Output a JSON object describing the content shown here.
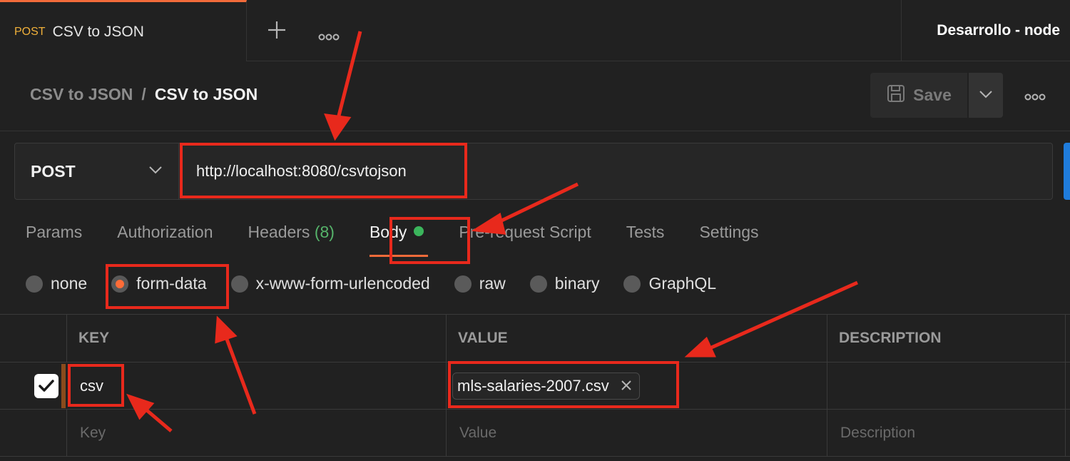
{
  "tabbar": {
    "active_tab": {
      "method": "POST",
      "name": "CSV to JSON"
    },
    "new_tab_icon": "plus-icon",
    "more_icon": "ellipsis-icon",
    "environment": "Desarrollo - node"
  },
  "header": {
    "breadcrumb": {
      "parent": "CSV to JSON",
      "separator": "/",
      "current": "CSV to JSON"
    },
    "save_label": "Save",
    "save_icon": "floppy-disk-icon",
    "more_icon": "ellipsis-icon"
  },
  "request": {
    "method": "POST",
    "url": "http://localhost:8080/csvtojson",
    "send_color": "#1f7cdc"
  },
  "tabs": [
    {
      "label": "Params"
    },
    {
      "label": "Authorization"
    },
    {
      "label": "Headers",
      "count": "(8)"
    },
    {
      "label": "Body",
      "active": true,
      "indicator_color": "#3bb55c"
    },
    {
      "label": "Pre-request Script"
    },
    {
      "label": "Tests"
    },
    {
      "label": "Settings"
    }
  ],
  "body_types": [
    {
      "label": "none"
    },
    {
      "label": "form-data",
      "selected": true
    },
    {
      "label": "x-www-form-urlencoded"
    },
    {
      "label": "raw"
    },
    {
      "label": "binary"
    },
    {
      "label": "GraphQL"
    }
  ],
  "table": {
    "headers": {
      "key": "KEY",
      "value": "VALUE",
      "description": "DESCRIPTION"
    },
    "rows": [
      {
        "checked": true,
        "key": "csv",
        "value": "mls-salaries-2007.csv",
        "description": ""
      }
    ],
    "placeholders": {
      "key": "Key",
      "value": "Value",
      "description": "Description"
    }
  },
  "colors": {
    "accent": "#ff6c37",
    "annotation": "#e8291c",
    "post_method": "#f0b03a",
    "background": "#212121"
  }
}
